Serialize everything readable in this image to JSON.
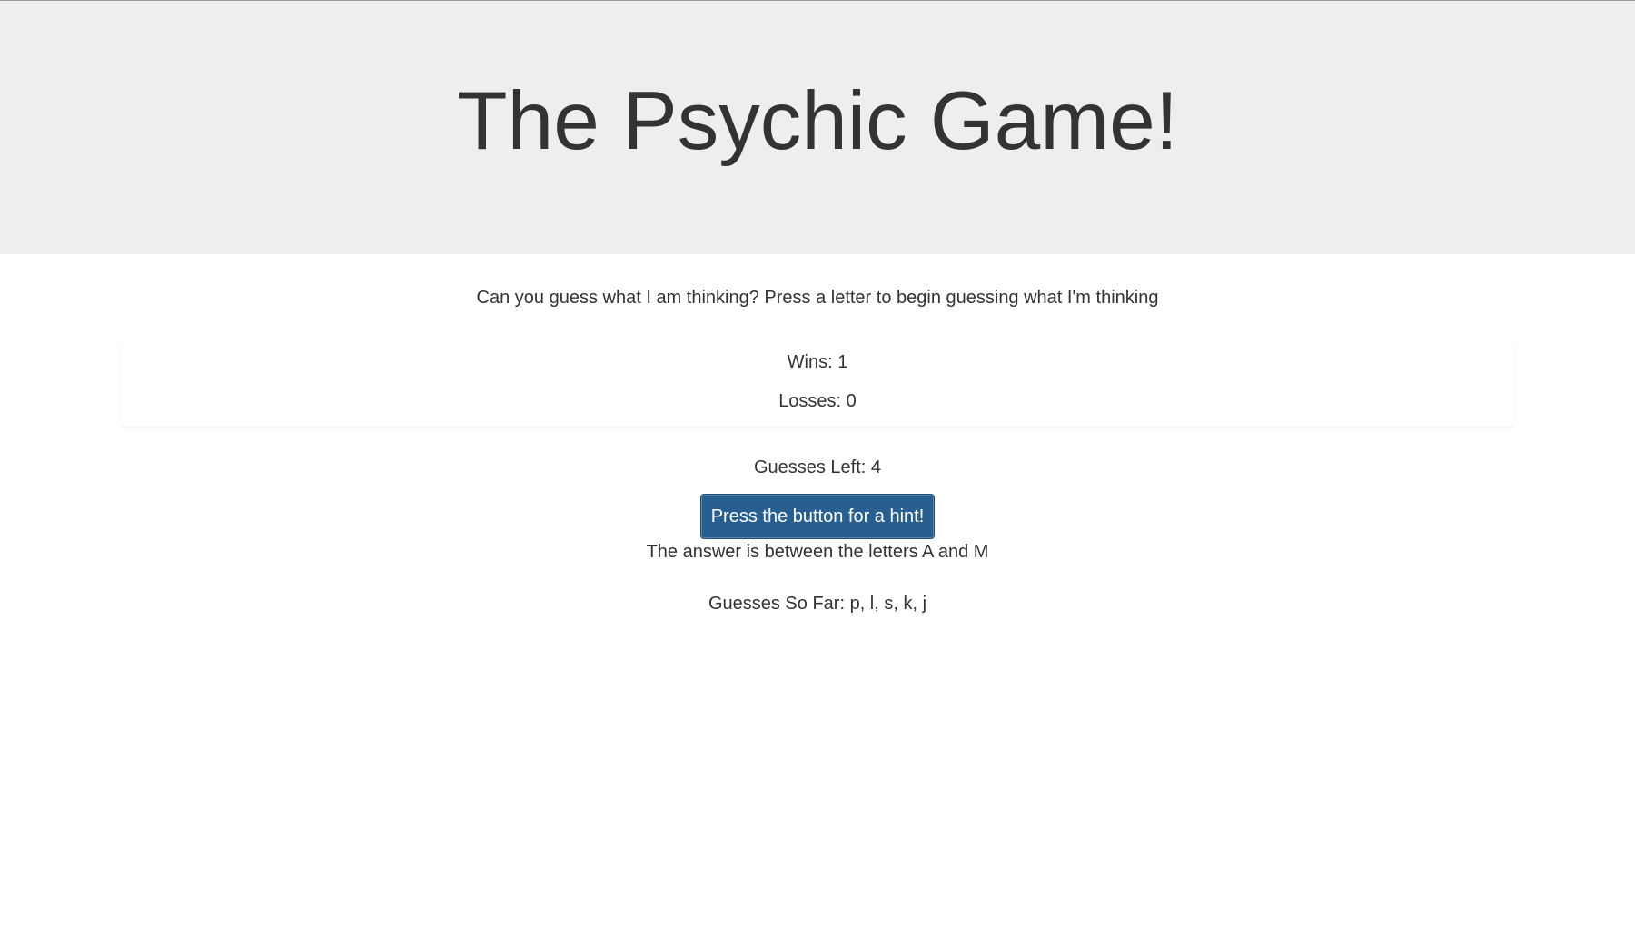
{
  "header": {
    "title": "The Psychic Game!"
  },
  "intro": {
    "text": "Can you guess what I am thinking? Press a letter to begin guessing what I'm thinking"
  },
  "scores": {
    "wins_label": "Wins: 1",
    "losses_label": "Losses: 0"
  },
  "status": {
    "guesses_left_label": "Guesses Left: 4",
    "hint_button_label": "Press the button for a hint!",
    "hint_text": "The answer is between the letters A and M",
    "guesses_so_far_label": "Guesses So Far: p, l, s, k, j"
  },
  "colors": {
    "jumbotron_bg": "#eeeeee",
    "button_bg": "#285f91",
    "text": "#333333"
  }
}
